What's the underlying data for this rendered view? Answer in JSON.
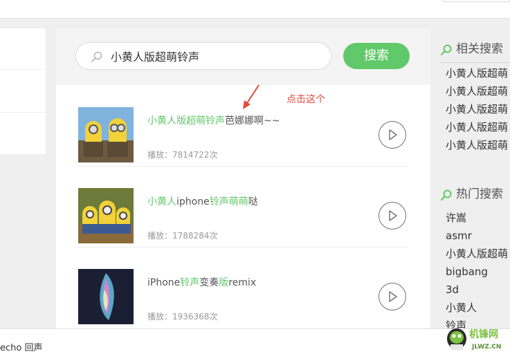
{
  "search": {
    "query": "小黄人版超萌铃声",
    "button_label": "搜索"
  },
  "annotation": {
    "text": "点击这个"
  },
  "results": [
    {
      "title_parts": [
        {
          "text": "小黄人版超萌铃声",
          "hl": true
        },
        {
          "text": "芭娜娜啊~~",
          "hl": false
        }
      ],
      "plays": "播放：7814722次"
    },
    {
      "title_parts": [
        {
          "text": "小黄人",
          "hl": true
        },
        {
          "text": "iphone",
          "hl": false
        },
        {
          "text": "铃声萌萌",
          "hl": true
        },
        {
          "text": "哒",
          "hl": false
        }
      ],
      "plays": "播放：1788284次"
    },
    {
      "title_parts": [
        {
          "text": "iPhone",
          "hl": false
        },
        {
          "text": "铃声",
          "hl": true
        },
        {
          "text": "变奏",
          "hl": false
        },
        {
          "text": "版",
          "hl": true
        },
        {
          "text": "remix",
          "hl": false
        }
      ],
      "plays": "播放：1936368次"
    }
  ],
  "related": {
    "heading": "相关搜索",
    "items": [
      "小黄人版超萌",
      "小黄人版超萌",
      "小黄人版超萌",
      "小黄人版超萌",
      "小黄人版超萌"
    ]
  },
  "hot": {
    "heading": "热门搜索",
    "items": [
      "许嵩",
      "asmr",
      "小黄人版超萌",
      "bigbang",
      "3d",
      "小黄人",
      "铃声"
    ]
  },
  "bottom": {
    "text": "echo 回声"
  },
  "watermark": {
    "text": "机锋网",
    "domain": "JLWZ.CN"
  },
  "colors": {
    "accent": "#62c96a",
    "annotation": "#e44a3a"
  }
}
